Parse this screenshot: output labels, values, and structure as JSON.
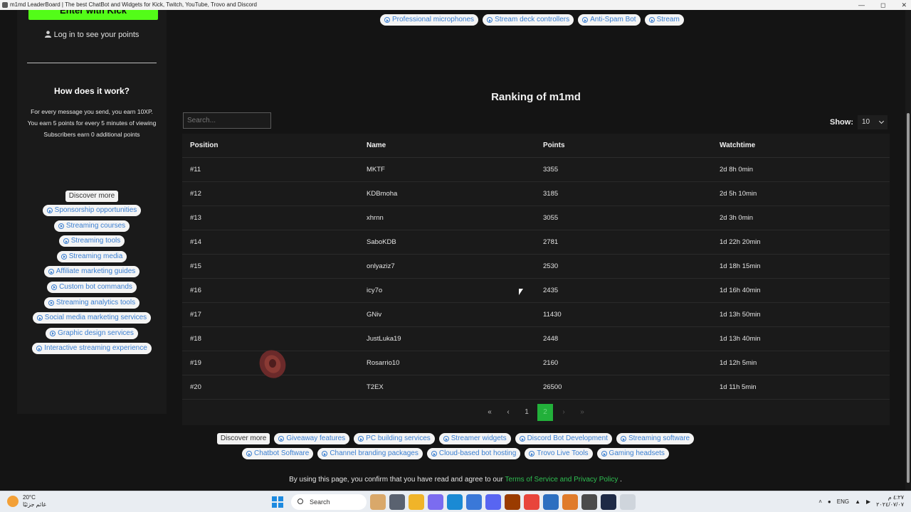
{
  "window": {
    "title": "m1md LeaderBoard | The best ChatBot and Widgets for Kick, Twitch, YouTube, Trovo and Discord"
  },
  "sidebar": {
    "kick_button": "Enter with Kick",
    "login_text": "Log in to see your points",
    "how_title": "How does it work?",
    "how_lines": [
      "For every message you send, you earn 10XP.",
      "You earn 5 points for every 5 minutes of viewing",
      "Subscribers earn 0 additional points"
    ],
    "discover_label": "Discover more",
    "links": [
      "Sponsorship opportunities",
      "Streaming courses",
      "Streaming tools",
      "Streaming media",
      "Affiliate marketing guides",
      "Custom bot commands",
      "Streaming analytics tools",
      "Social media marketing services",
      "Graphic design services",
      "Interactive streaming experience"
    ]
  },
  "top_links": [
    "Professional microphones",
    "Stream deck controllers",
    "Anti-Spam Bot",
    "Stream"
  ],
  "ranking": {
    "title": "Ranking of m1md",
    "search_placeholder": "Search...",
    "show_label": "Show:",
    "show_value": "10",
    "columns": [
      "Position",
      "Name",
      "Points",
      "Watchtime"
    ],
    "rows": [
      {
        "position": "#11",
        "name": "MKTF",
        "points": "3355",
        "watchtime": "2d 8h 0min"
      },
      {
        "position": "#12",
        "name": "KDBmoha",
        "points": "3185",
        "watchtime": "2d 5h 10min"
      },
      {
        "position": "#13",
        "name": "xhrnn",
        "points": "3055",
        "watchtime": "2d 3h 0min"
      },
      {
        "position": "#14",
        "name": "SaboKDB",
        "points": "2781",
        "watchtime": "1d 22h 20min"
      },
      {
        "position": "#15",
        "name": "onlyaziz7",
        "points": "2530",
        "watchtime": "1d 18h 15min"
      },
      {
        "position": "#16",
        "name": "icy7o",
        "points": "2435",
        "watchtime": "1d 16h 40min"
      },
      {
        "position": "#17",
        "name": "GNiv",
        "points": "11430",
        "watchtime": "1d 13h 50min"
      },
      {
        "position": "#18",
        "name": "JustLuka19",
        "points": "2448",
        "watchtime": "1d 13h 40min"
      },
      {
        "position": "#19",
        "name": "Rosarrio10",
        "points": "2160",
        "watchtime": "1d 12h 5min"
      },
      {
        "position": "#20",
        "name": "T2EX",
        "points": "26500",
        "watchtime": "1d 11h 5min"
      }
    ],
    "pagination": {
      "first": "«",
      "prev": "‹",
      "pages": [
        "1",
        "2"
      ],
      "current": "2",
      "next": "›",
      "last": "»"
    }
  },
  "footer": {
    "discover_label": "Discover more",
    "links_row1": [
      "Giveaway features",
      "PC building services",
      "Streamer widgets",
      "Discord Bot Development",
      "Streaming software"
    ],
    "links_row2": [
      "Chatbot Software",
      "Channel branding packages",
      "Cloud-based bot hosting",
      "Trovo Live Tools",
      "Gaming headsets"
    ],
    "note_prefix": "By using this page, you confirm that you have read and agree to our",
    "note_link": "Terms of Service and Privacy Policy",
    "note_suffix": "."
  },
  "taskbar": {
    "temperature": "20°C",
    "weather_text": "غائم جزئيًا",
    "search_label": "Search",
    "language": "ENG",
    "time": "٤:٢٧ م",
    "date": "٢٠٢٤/٠٧/٠٧"
  },
  "colors": {
    "kick_green": "#53fc18",
    "page_bg": "#141414",
    "card_bg": "#1a1a1a",
    "link_blue": "#3b7fd1",
    "active_page": "#22b03a",
    "tos_green": "#2fbf52"
  },
  "icons": {
    "user": "user-icon",
    "pill_arrow": "circle-arrow-icon",
    "show_chevron": "chevron-down-icon",
    "windows_start": "windows-start-icon",
    "search": "search-icon"
  }
}
